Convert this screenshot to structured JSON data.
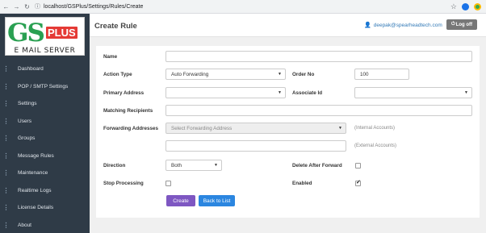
{
  "browser": {
    "url": "localhost/GSPlus/Settings/Rules/Create"
  },
  "logo": {
    "gs": "GS",
    "plus": "PLUS",
    "server": "E MAIL SERVER"
  },
  "sidebar": {
    "items": [
      {
        "label": "Dashboard"
      },
      {
        "label": "POP / SMTP Settings"
      },
      {
        "label": "Settings"
      },
      {
        "label": "Users"
      },
      {
        "label": "Groups"
      },
      {
        "label": "Message Rules"
      },
      {
        "label": "Maintenance"
      },
      {
        "label": "Realtime Logs"
      },
      {
        "label": "License Details"
      },
      {
        "label": "About"
      }
    ]
  },
  "header": {
    "title": "Create Rule",
    "user_email": "deepak@spearheadtech.com",
    "logoff_label": "Log off"
  },
  "form": {
    "name_label": "Name",
    "name_value": "",
    "action_type_label": "Action Type",
    "action_type_value": "Auto Forwarding",
    "order_no_label": "Order No",
    "order_no_value": "100",
    "primary_address_label": "Primary Address",
    "primary_address_value": "",
    "associate_id_label": "Associate Id",
    "associate_id_value": "",
    "matching_recipients_label": "Matching Recipients",
    "matching_recipients_value": "",
    "forwarding_addresses_label": "Forwarding Addresses",
    "forwarding_select_placeholder": "Select Forwarding Address",
    "internal_hint": "(Internal Accounts)",
    "external_value": "",
    "external_hint": "(External Accounts)",
    "direction_label": "Direction",
    "direction_value": "Both",
    "delete_after_forward_label": "Delete After Forward",
    "delete_after_forward_checked": false,
    "stop_processing_label": "Stop Processing",
    "stop_processing_checked": false,
    "enabled_label": "Enabled",
    "enabled_checked": true,
    "create_label": "Create",
    "back_label": "Back to List"
  }
}
